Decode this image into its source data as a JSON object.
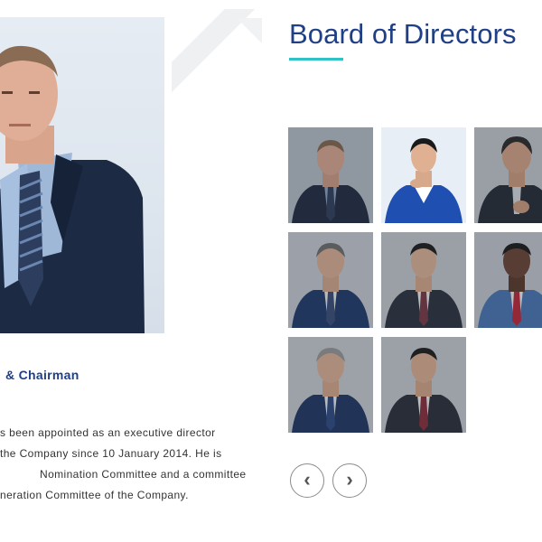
{
  "director_profile": {
    "role": "& Chairman",
    "bio_lines": [
      "s been appointed as an executive director",
      "the Company since 10 January 2014. He is",
      "Nomination Committee and a committee",
      "neration Committee of the Company."
    ]
  },
  "board": {
    "title": "Board of Directors",
    "accent_color": "#2ec2c5",
    "title_color": "#1f3f86",
    "tiles": [
      {
        "id": 1,
        "active": false
      },
      {
        "id": 2,
        "active": true
      },
      {
        "id": 3,
        "active": false
      },
      {
        "id": 4,
        "active": false
      },
      {
        "id": 5,
        "active": false
      },
      {
        "id": 6,
        "active": false
      },
      {
        "id": 7,
        "active": false
      },
      {
        "id": 8,
        "active": false
      }
    ],
    "prev_icon": "chevron-left-icon",
    "next_icon": "chevron-right-icon",
    "prev_glyph": "‹",
    "next_glyph": "›"
  }
}
